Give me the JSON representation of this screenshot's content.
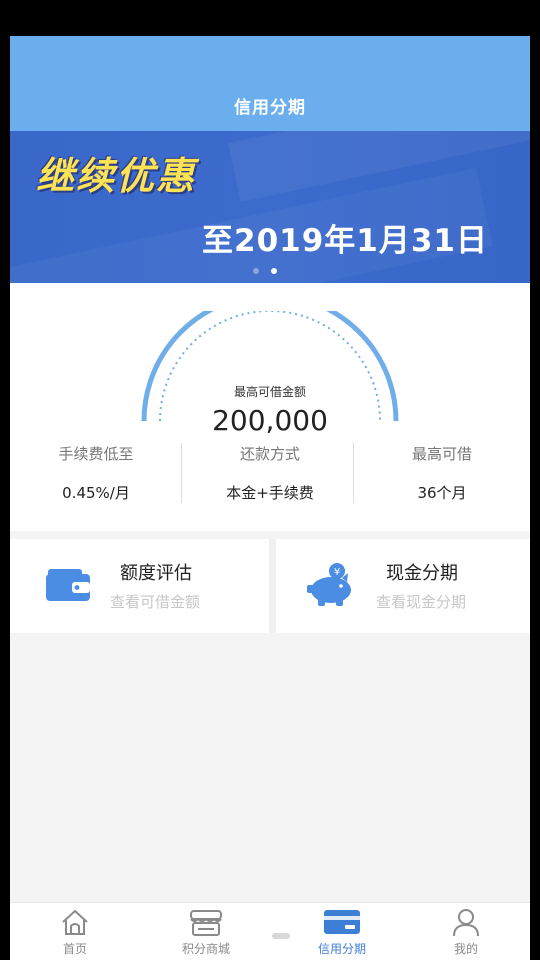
{
  "header": {
    "title": "信用分期"
  },
  "banner": {
    "headline": "继续优惠",
    "until": "至2019年1月31日",
    "pager": {
      "total": 2,
      "active_index": 1
    }
  },
  "credit": {
    "max_label": "最高可借金额",
    "max_amount": "200,000",
    "stats": [
      {
        "label": "手续费低至",
        "value": "0.45%/月"
      },
      {
        "label": "还款方式",
        "value": "本金+手续费"
      },
      {
        "label": "最高可借",
        "value": "36个月"
      }
    ]
  },
  "features": [
    {
      "name": "额度评估",
      "subtitle": "查看可借金额",
      "icon": "wallet-icon"
    },
    {
      "name": "现金分期",
      "subtitle": "查看现金分期",
      "icon": "piggy-bank-icon"
    }
  ],
  "tabbar": {
    "items": [
      {
        "label": "首页",
        "icon": "home-icon"
      },
      {
        "label": "积分商城",
        "icon": "store-icon"
      },
      {
        "label": "信用分期",
        "icon": "card-icon"
      },
      {
        "label": "我的",
        "icon": "user-icon"
      }
    ],
    "active_index": 2
  },
  "colors": {
    "header_bg": "#6aaeed",
    "banner_bg": "#3a68c9",
    "banner_headline": "#ffe352",
    "accent": "#3e7fd6",
    "icon_blue": "#4a8de2"
  }
}
